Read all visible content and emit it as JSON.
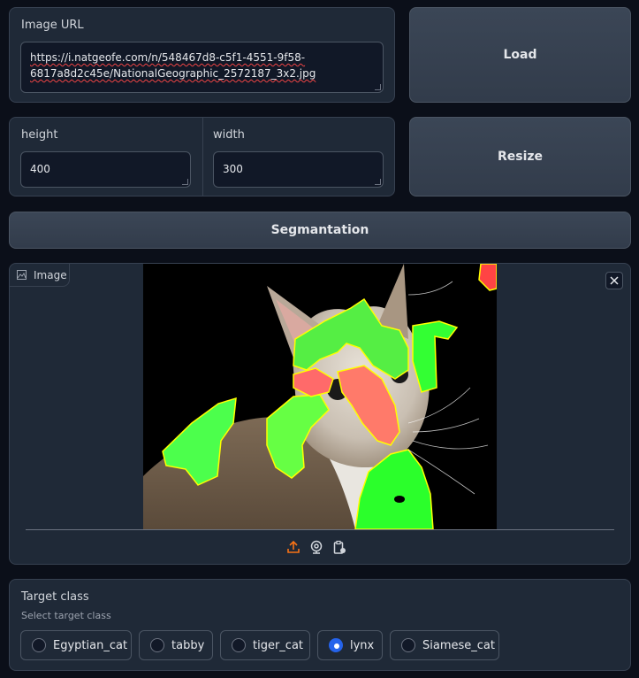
{
  "url_panel": {
    "label": "Image URL",
    "value_line1": "https://i.natgeofe.com/n/548467d8-c5f1-4551-9f58-",
    "value_line2": "6817a8d2c45e/NationalGeographic_2572187_3x2.jpg"
  },
  "load_button": "Load",
  "size_panel": {
    "height_label": "height",
    "height_value": "400",
    "width_label": "width",
    "width_value": "300"
  },
  "resize_button": "Resize",
  "segment_button": "Segmantation",
  "image_panel": {
    "tab_label": "Image",
    "icons": [
      "image-icon",
      "close-icon",
      "upload-icon",
      "webcam-icon",
      "clipboard-icon"
    ]
  },
  "target": {
    "title": "Target class",
    "subtitle": "Select target class",
    "options": [
      "Egyptian_cat",
      "tabby",
      "tiger_cat",
      "lynx",
      "Siamese_cat"
    ],
    "selected": "lynx"
  },
  "colors": {
    "background": "#0b0f19",
    "panel": "#1f2937",
    "accent": "#2563eb",
    "upload_icon": "#f97316",
    "mask_green": "#33ff33",
    "mask_red": "#ff6a6a",
    "mask_outline": "#ffff00"
  }
}
